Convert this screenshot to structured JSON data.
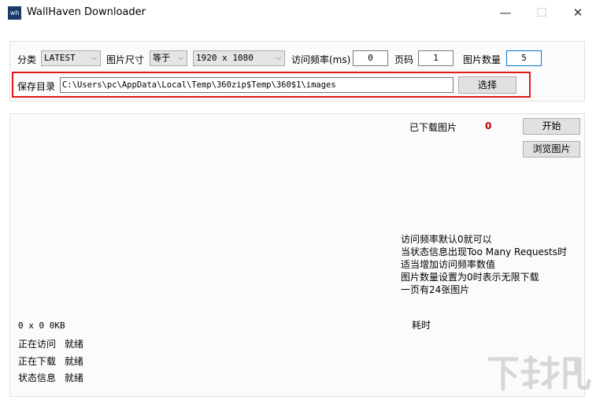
{
  "window": {
    "title": "WallHaven Downloader",
    "icon_text": "wh"
  },
  "controls": {
    "category_label": "分类",
    "category_value": "LATEST",
    "size_label": "图片尺寸",
    "size_op_value": "等于",
    "resolution_value": "1920 x 1080",
    "freq_label": "访问频率(ms)",
    "freq_value": "0",
    "page_label": "页码",
    "page_value": "1",
    "count_label": "图片数量",
    "count_value": "5",
    "save_label": "保存目录",
    "save_path": "C:\\Users\\pc\\AppData\\Local\\Temp\\360zip$Temp\\360$1\\images",
    "choose_button": "选择"
  },
  "main": {
    "downloaded_label": "已下载图片",
    "downloaded_count": "0",
    "start_button": "开始",
    "browse_button": "浏览图片",
    "tips": [
      "访问频率默认0就可以",
      "当状态信息出现Too Many Requests时",
      "适当增加访问频率数值",
      "图片数量设置为0时表示无限下载",
      "一页有24张图片"
    ],
    "elapsed_label": "耗时",
    "size_info": "0 x 0 0KB",
    "visiting_label": "正在访问",
    "visiting_value": "就绪",
    "downloading_label": "正在下载",
    "downloading_value": "就绪",
    "status_label": "状态信息",
    "status_value": "就绪"
  },
  "watermark": {
    "text": "下载吧"
  },
  "colors": {
    "highlight": "#e0191b",
    "count": "#c00000",
    "panel_border": "#e1e1e1"
  }
}
